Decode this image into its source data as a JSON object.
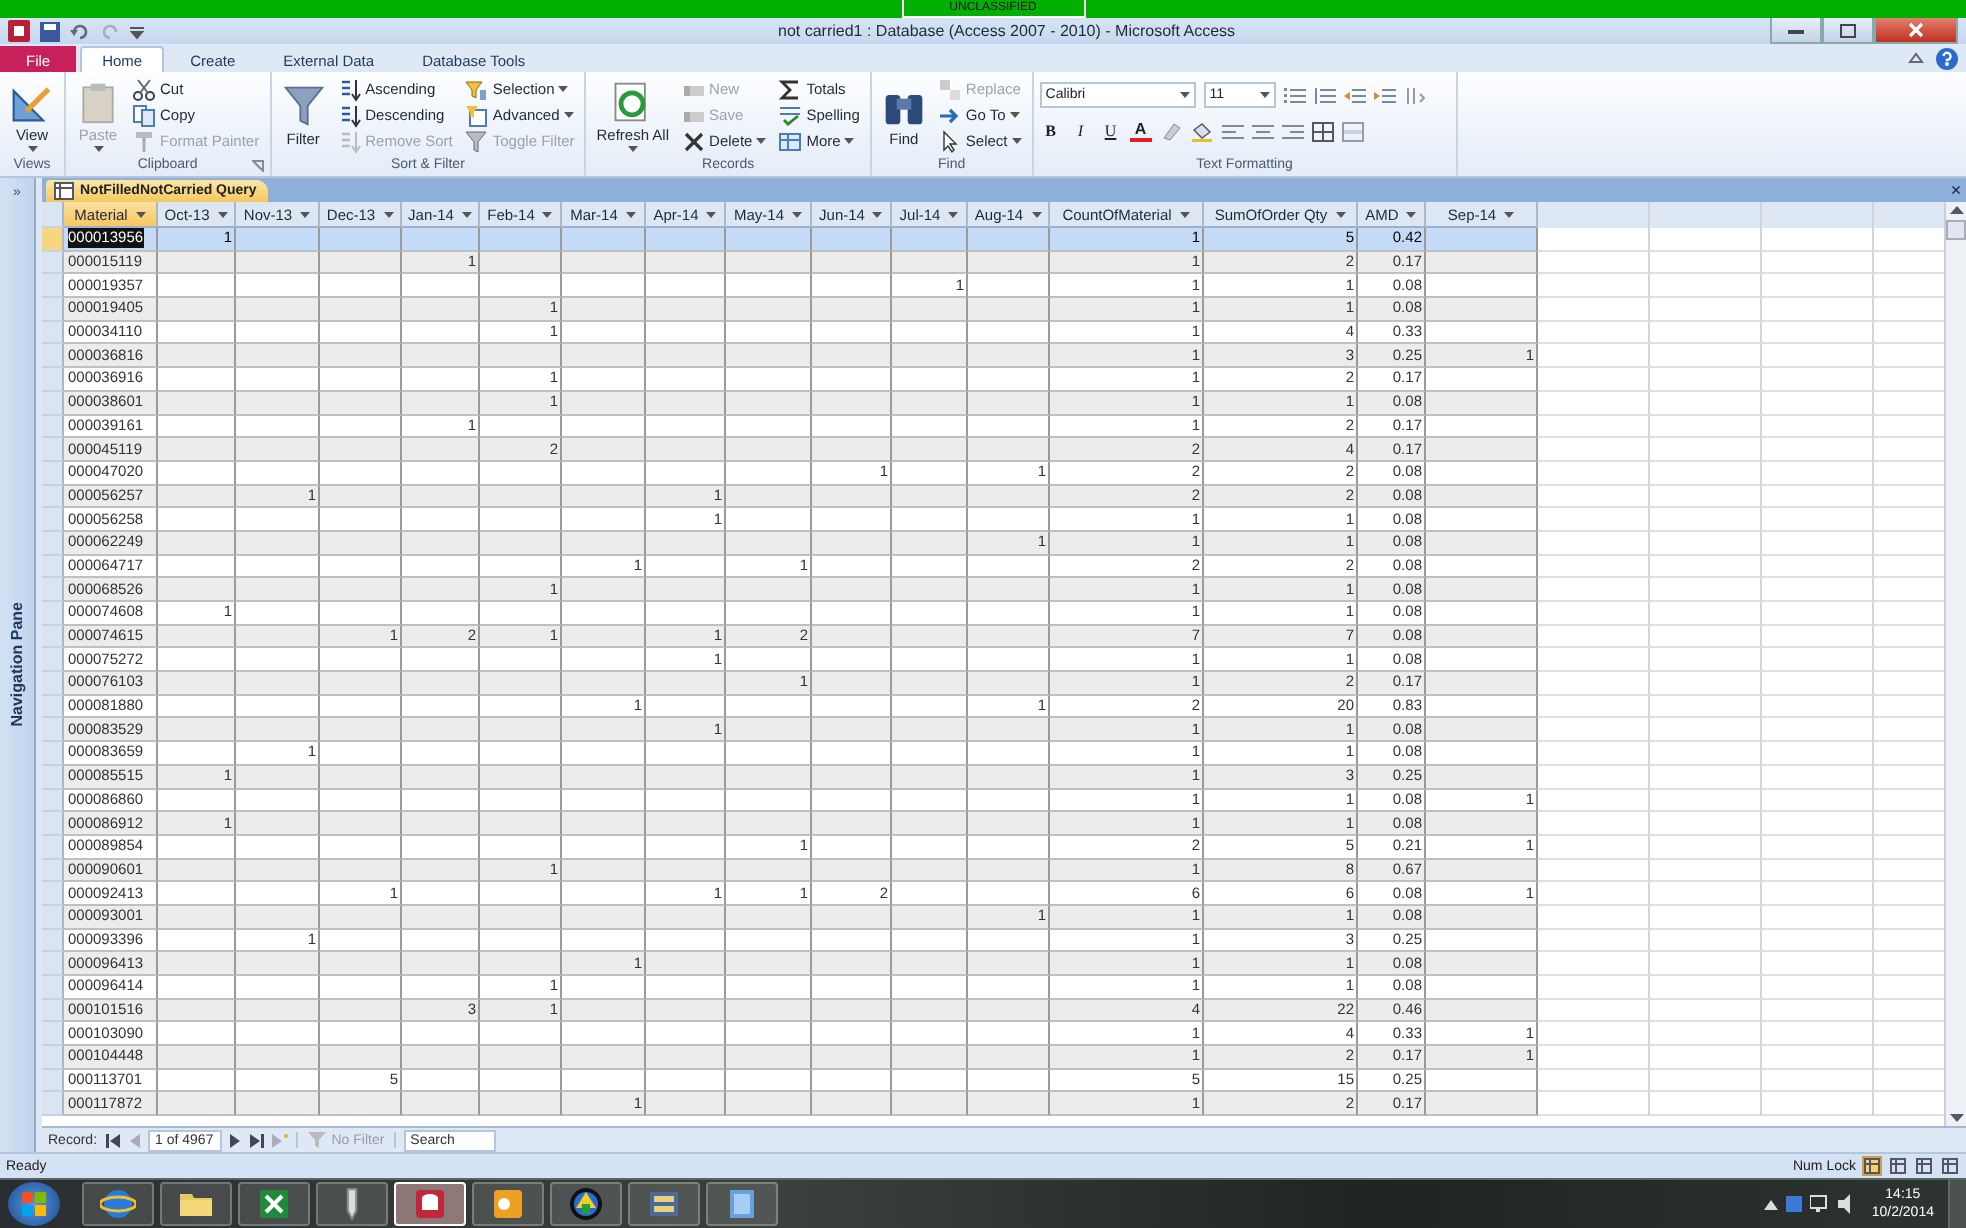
{
  "banner": {
    "text": "UNCLASSIFIED"
  },
  "window": {
    "title": "not carried1 : Database (Access 2007 - 2010)  -  Microsoft Access"
  },
  "ribbon": {
    "tabs": [
      {
        "label": "File",
        "kind": "file",
        "selected": false
      },
      {
        "label": "Home",
        "kind": "tab",
        "selected": true
      },
      {
        "label": "Create",
        "kind": "tab",
        "selected": false
      },
      {
        "label": "External Data",
        "kind": "tab",
        "selected": false
      },
      {
        "label": "Database Tools",
        "kind": "tab",
        "selected": false
      }
    ],
    "groups": [
      {
        "label": "Views",
        "launcher": false,
        "items": [
          {
            "label": "View",
            "kind": "large",
            "disabled": false,
            "dropdown": true
          }
        ]
      },
      {
        "label": "Clipboard",
        "launcher": true,
        "items": [
          {
            "label": "Paste",
            "kind": "large",
            "disabled": true,
            "dropdown": true
          },
          {
            "label": "Cut",
            "kind": "small",
            "disabled": false,
            "dropdown": false
          },
          {
            "label": "Copy",
            "kind": "small",
            "disabled": false,
            "dropdown": false
          },
          {
            "label": "Format Painter",
            "kind": "small",
            "disabled": true,
            "dropdown": false
          }
        ]
      },
      {
        "label": "Sort & Filter",
        "launcher": false,
        "items": [
          {
            "label": "Filter",
            "kind": "large",
            "disabled": false,
            "dropdown": false
          },
          {
            "label": "Ascending",
            "kind": "small",
            "disabled": false,
            "dropdown": false
          },
          {
            "label": "Descending",
            "kind": "small",
            "disabled": false,
            "dropdown": false
          },
          {
            "label": "Remove Sort",
            "kind": "small",
            "disabled": true,
            "dropdown": false
          },
          {
            "label": "Selection",
            "kind": "small",
            "disabled": false,
            "dropdown": true
          },
          {
            "label": "Advanced",
            "kind": "small",
            "disabled": false,
            "dropdown": true
          },
          {
            "label": "Toggle Filter",
            "kind": "small",
            "disabled": true,
            "dropdown": false
          }
        ]
      },
      {
        "label": "Records",
        "launcher": false,
        "items": [
          {
            "label": "Refresh All",
            "kind": "large",
            "disabled": false,
            "dropdown": true
          },
          {
            "label": "New",
            "kind": "small",
            "disabled": true,
            "dropdown": false
          },
          {
            "label": "Save",
            "kind": "small",
            "disabled": true,
            "dropdown": false
          },
          {
            "label": "Delete",
            "kind": "small",
            "disabled": false,
            "dropdown": true
          },
          {
            "label": "Totals",
            "kind": "small",
            "disabled": false,
            "dropdown": false
          },
          {
            "label": "Spelling",
            "kind": "small",
            "disabled": false,
            "dropdown": false
          },
          {
            "label": "More",
            "kind": "small",
            "disabled": false,
            "dropdown": true
          }
        ]
      },
      {
        "label": "Find",
        "launcher": false,
        "items": [
          {
            "label": "Find",
            "kind": "large",
            "disabled": false,
            "dropdown": false
          },
          {
            "label": "Replace",
            "kind": "small",
            "disabled": true,
            "dropdown": false
          },
          {
            "label": "Go To",
            "kind": "small",
            "disabled": false,
            "dropdown": true
          },
          {
            "label": "Select",
            "kind": "small",
            "disabled": false,
            "dropdown": true
          }
        ]
      }
    ],
    "text_formatting": {
      "label": "Text Formatting",
      "font": "Calibri",
      "size": "11",
      "glyphs": [
        {
          "label": "B",
          "kind": "bold"
        },
        {
          "label": "I",
          "kind": "italic"
        },
        {
          "label": "U",
          "kind": "underline"
        },
        {
          "label": "A",
          "kind": "color"
        }
      ]
    }
  },
  "document": {
    "tab": "NotFilledNotCarried Query",
    "close": "×"
  },
  "navigation_pane": {
    "toggle": "»",
    "label": "Navigation Pane"
  },
  "table": {
    "columns": [
      {
        "label": "Material",
        "selected": true
      },
      {
        "label": "Oct-13",
        "selected": false
      },
      {
        "label": "Nov-13",
        "selected": false
      },
      {
        "label": "Dec-13",
        "selected": false
      },
      {
        "label": "Jan-14",
        "selected": false
      },
      {
        "label": "Feb-14",
        "selected": false
      },
      {
        "label": "Mar-14",
        "selected": false
      },
      {
        "label": "Apr-14",
        "selected": false
      },
      {
        "label": "May-14",
        "selected": false
      },
      {
        "label": "Jun-14",
        "selected": false
      },
      {
        "label": "Jul-14",
        "selected": false
      },
      {
        "label": "Aug-14",
        "selected": false
      },
      {
        "label": "CountOfMaterial",
        "selected": false
      },
      {
        "label": "SumOfOrder Qty",
        "selected": false
      },
      {
        "label": "AMD",
        "selected": false
      },
      {
        "label": "Sep-14",
        "selected": false
      }
    ],
    "rows": [
      {
        "selected": true,
        "cells": [
          "000013956",
          "1",
          null,
          null,
          null,
          null,
          null,
          null,
          null,
          null,
          null,
          null,
          "1",
          "5",
          "0.42",
          null
        ]
      },
      {
        "selected": false,
        "cells": [
          "000015119",
          null,
          null,
          null,
          "1",
          null,
          null,
          null,
          null,
          null,
          null,
          null,
          "1",
          "2",
          "0.17",
          null
        ]
      },
      {
        "selected": false,
        "cells": [
          "000019357",
          null,
          null,
          null,
          null,
          null,
          null,
          null,
          null,
          null,
          "1",
          null,
          "1",
          "1",
          "0.08",
          null
        ]
      },
      {
        "selected": false,
        "cells": [
          "000019405",
          null,
          null,
          null,
          null,
          "1",
          null,
          null,
          null,
          null,
          null,
          null,
          "1",
          "1",
          "0.08",
          null
        ]
      },
      {
        "selected": false,
        "cells": [
          "000034110",
          null,
          null,
          null,
          null,
          "1",
          null,
          null,
          null,
          null,
          null,
          null,
          "1",
          "4",
          "0.33",
          null
        ]
      },
      {
        "selected": false,
        "cells": [
          "000036816",
          null,
          null,
          null,
          null,
          null,
          null,
          null,
          null,
          null,
          null,
          null,
          "1",
          "3",
          "0.25",
          "1"
        ]
      },
      {
        "selected": false,
        "cells": [
          "000036916",
          null,
          null,
          null,
          null,
          "1",
          null,
          null,
          null,
          null,
          null,
          null,
          "1",
          "2",
          "0.17",
          null
        ]
      },
      {
        "selected": false,
        "cells": [
          "000038601",
          null,
          null,
          null,
          null,
          "1",
          null,
          null,
          null,
          null,
          null,
          null,
          "1",
          "1",
          "0.08",
          null
        ]
      },
      {
        "selected": false,
        "cells": [
          "000039161",
          null,
          null,
          null,
          "1",
          null,
          null,
          null,
          null,
          null,
          null,
          null,
          "1",
          "2",
          "0.17",
          null
        ]
      },
      {
        "selected": false,
        "cells": [
          "000045119",
          null,
          null,
          null,
          null,
          "2",
          null,
          null,
          null,
          null,
          null,
          null,
          "2",
          "4",
          "0.17",
          null
        ]
      },
      {
        "selected": false,
        "cells": [
          "000047020",
          null,
          null,
          null,
          null,
          null,
          null,
          null,
          null,
          "1",
          null,
          "1",
          "2",
          "2",
          "0.08",
          null
        ]
      },
      {
        "selected": false,
        "cells": [
          "000056257",
          null,
          "1",
          null,
          null,
          null,
          null,
          "1",
          null,
          null,
          null,
          null,
          "2",
          "2",
          "0.08",
          null
        ]
      },
      {
        "selected": false,
        "cells": [
          "000056258",
          null,
          null,
          null,
          null,
          null,
          null,
          "1",
          null,
          null,
          null,
          null,
          "1",
          "1",
          "0.08",
          null
        ]
      },
      {
        "selected": false,
        "cells": [
          "000062249",
          null,
          null,
          null,
          null,
          null,
          null,
          null,
          null,
          null,
          null,
          "1",
          "1",
          "1",
          "0.08",
          null
        ]
      },
      {
        "selected": false,
        "cells": [
          "000064717",
          null,
          null,
          null,
          null,
          null,
          "1",
          null,
          "1",
          null,
          null,
          null,
          "2",
          "2",
          "0.08",
          null
        ]
      },
      {
        "selected": false,
        "cells": [
          "000068526",
          null,
          null,
          null,
          null,
          "1",
          null,
          null,
          null,
          null,
          null,
          null,
          "1",
          "1",
          "0.08",
          null
        ]
      },
      {
        "selected": false,
        "cells": [
          "000074608",
          "1",
          null,
          null,
          null,
          null,
          null,
          null,
          null,
          null,
          null,
          null,
          "1",
          "1",
          "0.08",
          null
        ]
      },
      {
        "selected": false,
        "cells": [
          "000074615",
          null,
          null,
          "1",
          "2",
          "1",
          null,
          "1",
          "2",
          null,
          null,
          null,
          "7",
          "7",
          "0.08",
          null
        ]
      },
      {
        "selected": false,
        "cells": [
          "000075272",
          null,
          null,
          null,
          null,
          null,
          null,
          "1",
          null,
          null,
          null,
          null,
          "1",
          "1",
          "0.08",
          null
        ]
      },
      {
        "selected": false,
        "cells": [
          "000076103",
          null,
          null,
          null,
          null,
          null,
          null,
          null,
          "1",
          null,
          null,
          null,
          "1",
          "2",
          "0.17",
          null
        ]
      },
      {
        "selected": false,
        "cells": [
          "000081880",
          null,
          null,
          null,
          null,
          null,
          "1",
          null,
          null,
          null,
          null,
          "1",
          "2",
          "20",
          "0.83",
          null
        ]
      },
      {
        "selected": false,
        "cells": [
          "000083529",
          null,
          null,
          null,
          null,
          null,
          null,
          "1",
          null,
          null,
          null,
          null,
          "1",
          "1",
          "0.08",
          null
        ]
      },
      {
        "selected": false,
        "cells": [
          "000083659",
          null,
          "1",
          null,
          null,
          null,
          null,
          null,
          null,
          null,
          null,
          null,
          "1",
          "1",
          "0.08",
          null
        ]
      },
      {
        "selected": false,
        "cells": [
          "000085515",
          "1",
          null,
          null,
          null,
          null,
          null,
          null,
          null,
          null,
          null,
          null,
          "1",
          "3",
          "0.25",
          null
        ]
      },
      {
        "selected": false,
        "cells": [
          "000086860",
          null,
          null,
          null,
          null,
          null,
          null,
          null,
          null,
          null,
          null,
          null,
          "1",
          "1",
          "0.08",
          "1"
        ]
      },
      {
        "selected": false,
        "cells": [
          "000086912",
          "1",
          null,
          null,
          null,
          null,
          null,
          null,
          null,
          null,
          null,
          null,
          "1",
          "1",
          "0.08",
          null
        ]
      },
      {
        "selected": false,
        "cells": [
          "000089854",
          null,
          null,
          null,
          null,
          null,
          null,
          null,
          "1",
          null,
          null,
          null,
          "2",
          "5",
          "0.21",
          "1"
        ]
      },
      {
        "selected": false,
        "cells": [
          "000090601",
          null,
          null,
          null,
          null,
          "1",
          null,
          null,
          null,
          null,
          null,
          null,
          "1",
          "8",
          "0.67",
          null
        ]
      },
      {
        "selected": false,
        "cells": [
          "000092413",
          null,
          null,
          "1",
          null,
          null,
          null,
          "1",
          "1",
          "2",
          null,
          null,
          "6",
          "6",
          "0.08",
          "1"
        ]
      },
      {
        "selected": false,
        "cells": [
          "000093001",
          null,
          null,
          null,
          null,
          null,
          null,
          null,
          null,
          null,
          null,
          "1",
          "1",
          "1",
          "0.08",
          null
        ]
      },
      {
        "selected": false,
        "cells": [
          "000093396",
          null,
          "1",
          null,
          null,
          null,
          null,
          null,
          null,
          null,
          null,
          null,
          "1",
          "3",
          "0.25",
          null
        ]
      },
      {
        "selected": false,
        "cells": [
          "000096413",
          null,
          null,
          null,
          null,
          null,
          "1",
          null,
          null,
          null,
          null,
          null,
          "1",
          "1",
          "0.08",
          null
        ]
      },
      {
        "selected": false,
        "cells": [
          "000096414",
          null,
          null,
          null,
          null,
          "1",
          null,
          null,
          null,
          null,
          null,
          null,
          "1",
          "1",
          "0.08",
          null
        ]
      },
      {
        "selected": false,
        "cells": [
          "000101516",
          null,
          null,
          null,
          "3",
          "1",
          null,
          null,
          null,
          null,
          null,
          null,
          "4",
          "22",
          "0.46",
          null
        ]
      },
      {
        "selected": false,
        "cells": [
          "000103090",
          null,
          null,
          null,
          null,
          null,
          null,
          null,
          null,
          null,
          null,
          null,
          "1",
          "4",
          "0.33",
          "1"
        ]
      },
      {
        "selected": false,
        "cells": [
          "000104448",
          null,
          null,
          null,
          null,
          null,
          null,
          null,
          null,
          null,
          null,
          null,
          "1",
          "2",
          "0.17",
          "1"
        ]
      },
      {
        "selected": false,
        "cells": [
          "000113701",
          null,
          null,
          "5",
          null,
          null,
          null,
          null,
          null,
          null,
          null,
          null,
          "5",
          "15",
          "0.25",
          null
        ]
      },
      {
        "selected": false,
        "cells": [
          "000117872",
          null,
          null,
          null,
          null,
          null,
          "1",
          null,
          null,
          null,
          null,
          null,
          "1",
          "2",
          "0.17",
          null
        ]
      }
    ]
  },
  "record_nav": {
    "label": "Record:",
    "position": "1 of 4967",
    "filter": "No Filter",
    "search_placeholder": "Search"
  },
  "status_bar": {
    "text": "Ready",
    "indicator": "Num Lock",
    "views": [
      {
        "selected": true
      },
      {
        "selected": false
      },
      {
        "selected": false
      },
      {
        "selected": false
      }
    ]
  },
  "taskbar": {
    "apps": [
      {
        "selected": false
      },
      {
        "selected": false
      },
      {
        "selected": false
      },
      {
        "selected": false
      },
      {
        "selected": true
      },
      {
        "selected": false
      },
      {
        "selected": false
      },
      {
        "selected": false
      },
      {
        "selected": false
      }
    ],
    "time": "14:15",
    "date": "10/2/2014"
  }
}
